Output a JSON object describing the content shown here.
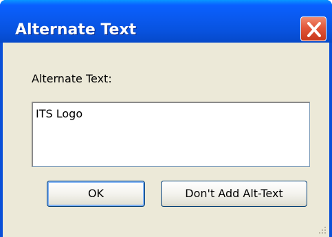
{
  "dialog": {
    "title": "Alternate Text",
    "close_icon": "close-icon",
    "field_label": "Alternate Text:",
    "field_value": "ITS Logo",
    "ok_label": "OK",
    "no_alt_label": "Don't Add Alt-Text",
    "colors": {
      "titlebar": "#0a5af0",
      "client": "#ece9d8",
      "close": "#e2573b"
    }
  }
}
